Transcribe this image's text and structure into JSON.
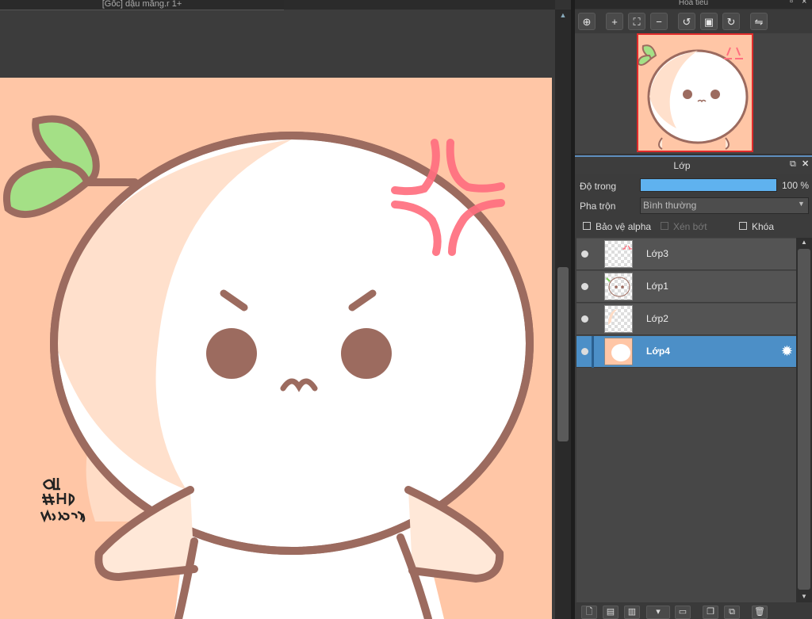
{
  "document_tab": {
    "title": "[Gốc] dậu mắng.r 1+"
  },
  "navigator": {
    "title": "Hoa tiêu",
    "tools": [
      {
        "name": "zoom-fit-icon",
        "glyph": "⊕"
      },
      {
        "name": "zoom-in-icon",
        "glyph": "+"
      },
      {
        "name": "fit-window-icon",
        "glyph": "⛶"
      },
      {
        "name": "zoom-out-icon",
        "glyph": "−"
      },
      {
        "name": "rotate-left-icon",
        "glyph": "↺"
      },
      {
        "name": "reset-view-icon",
        "glyph": "▣"
      },
      {
        "name": "rotate-right-icon",
        "glyph": "↻"
      },
      {
        "name": "flip-horizontal-icon",
        "glyph": "⇋"
      }
    ]
  },
  "layer_panel": {
    "title": "Lớp",
    "opacity_label": "Độ trong",
    "opacity_value": "100 %",
    "opacity_fraction": 1.0,
    "blend_label": "Pha trộn",
    "blend_value": "Bình thường",
    "options": [
      {
        "label": "Bảo vệ alpha",
        "checked": false,
        "disabled": false
      },
      {
        "label": "Xén bớt",
        "checked": false,
        "disabled": true
      },
      {
        "label": "Khóa",
        "checked": false,
        "disabled": false
      }
    ],
    "layers": [
      {
        "name": "Lớp3",
        "selected": false
      },
      {
        "name": "Lớp1",
        "selected": false
      },
      {
        "name": "Lớp2",
        "selected": false
      },
      {
        "name": "Lớp4",
        "selected": true
      }
    ],
    "bottom_tools": [
      {
        "name": "new-layer-icon",
        "glyph": "🗋"
      },
      {
        "name": "new-raster-icon",
        "glyph": "▤"
      },
      {
        "name": "new-1bit-icon",
        "glyph": "▥"
      },
      {
        "name": "add-layer-menu-icon",
        "glyph": "▾"
      },
      {
        "name": "folder-icon",
        "glyph": "▭"
      },
      {
        "name": "duplicate-icon",
        "glyph": "❐"
      },
      {
        "name": "merge-icon",
        "glyph": "⧉"
      },
      {
        "name": "trash-icon",
        "glyph": "🗑"
      }
    ]
  },
  "colors": {
    "canvas_bg": "#ffc6a6",
    "outline": "#9c6b5f",
    "leaf": "#a4e086",
    "angry_mark": "#ff6f7f",
    "selected_layer": "#4c8fc7"
  }
}
